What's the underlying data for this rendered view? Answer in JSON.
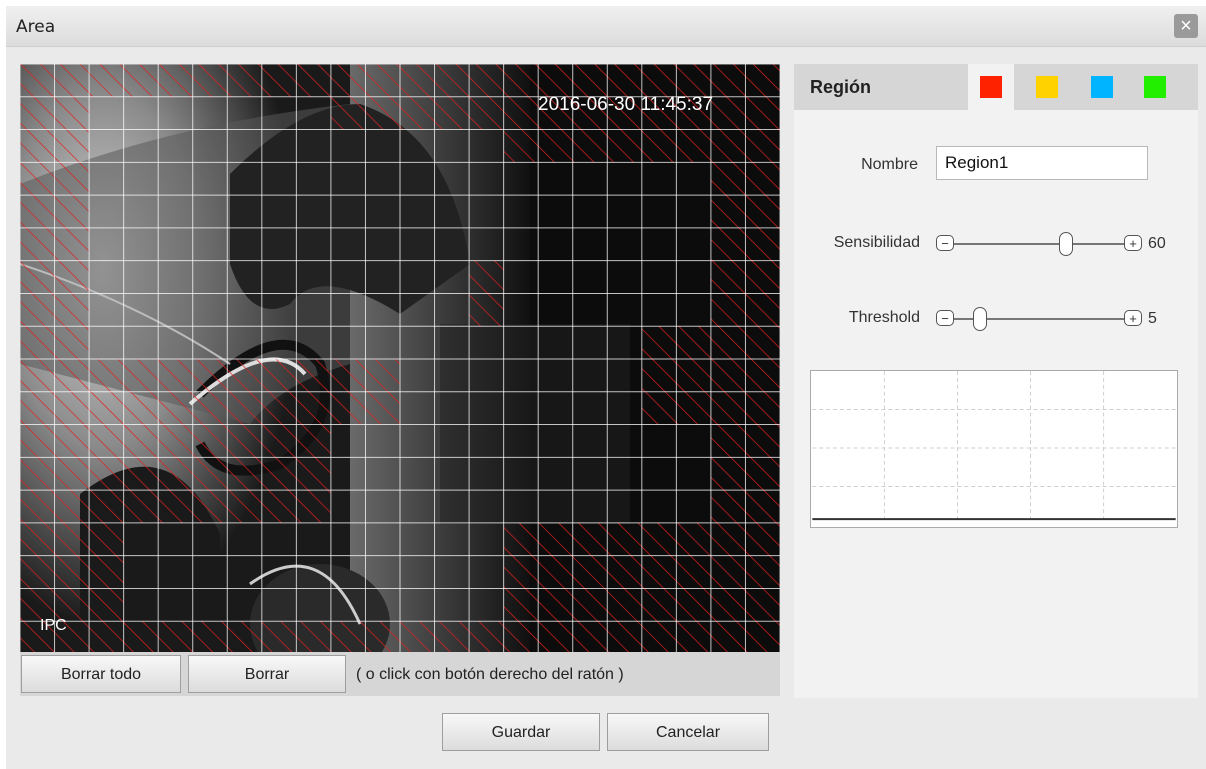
{
  "window": {
    "title": "Area",
    "close_icon": "close-icon"
  },
  "video": {
    "timestamp": "2016-06-30 11:45:37",
    "osd_label": "IPC",
    "grid": {
      "columns": 22,
      "rows": 18,
      "selection_color": "#e02020"
    }
  },
  "video_toolbar": {
    "clear_all_label": "Borrar todo",
    "clear_label": "Borrar",
    "hint": "( o click con botón derecho del ratón )"
  },
  "region": {
    "label": "Región",
    "swatches": [
      {
        "name": "red",
        "color": "#ff2200",
        "selected": true
      },
      {
        "name": "yellow",
        "color": "#ffd200"
      },
      {
        "name": "blue",
        "color": "#00b4ff"
      },
      {
        "name": "green",
        "color": "#22ee00"
      }
    ],
    "name_label": "Nombre",
    "name_value": "Region1",
    "sensitivity_label": "Sensibilidad",
    "sensitivity_value": "60",
    "sensitivity_level": 0.6,
    "threshold_label": "Threshold",
    "threshold_value": "5",
    "threshold_level": 0.05
  },
  "actions": {
    "save_label": "Guardar",
    "cancel_label": "Cancelar"
  }
}
